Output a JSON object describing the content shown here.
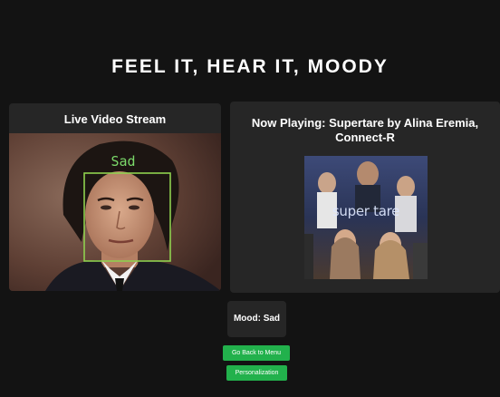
{
  "app": {
    "title": "FEEL IT, HEAR IT, MOODY"
  },
  "video": {
    "title": "Live Video Stream",
    "detection_label": "Sad",
    "box_color": "#8fd14f",
    "label_color": "#7bd96a"
  },
  "player": {
    "title": "Now Playing: Supertare by Alina Eremia, Connect-R",
    "album_text": "super tare"
  },
  "mood": {
    "label": "Mood: Sad"
  },
  "buttons": {
    "back_label": "Go Back to Menu",
    "personalization_label": "Personalization"
  },
  "colors": {
    "background": "#131313",
    "panel": "#262626",
    "button": "#22b14c"
  }
}
